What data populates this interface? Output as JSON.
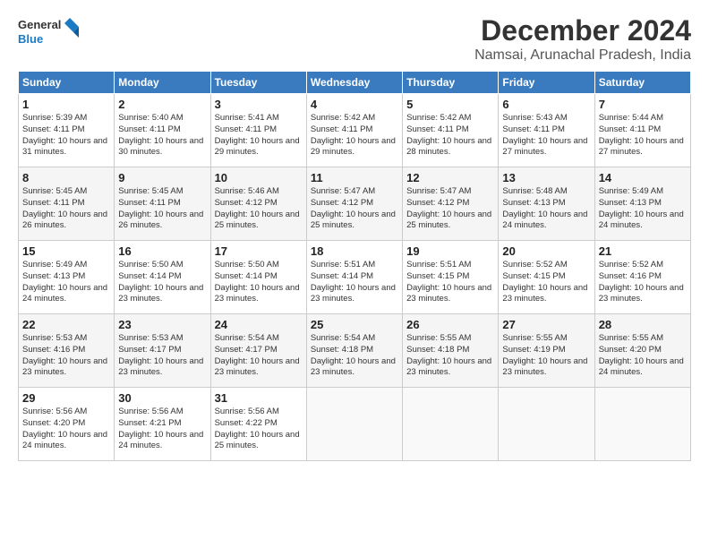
{
  "logo": {
    "line1": "General",
    "line2": "Blue"
  },
  "title": "December 2024",
  "subtitle": "Namsai, Arunachal Pradesh, India",
  "days_header": [
    "Sunday",
    "Monday",
    "Tuesday",
    "Wednesday",
    "Thursday",
    "Friday",
    "Saturday"
  ],
  "weeks": [
    [
      {
        "day": "1",
        "sunrise": "5:39 AM",
        "sunset": "4:11 PM",
        "daylight": "10 hours and 31 minutes."
      },
      {
        "day": "2",
        "sunrise": "5:40 AM",
        "sunset": "4:11 PM",
        "daylight": "10 hours and 30 minutes."
      },
      {
        "day": "3",
        "sunrise": "5:41 AM",
        "sunset": "4:11 PM",
        "daylight": "10 hours and 29 minutes."
      },
      {
        "day": "4",
        "sunrise": "5:42 AM",
        "sunset": "4:11 PM",
        "daylight": "10 hours and 29 minutes."
      },
      {
        "day": "5",
        "sunrise": "5:42 AM",
        "sunset": "4:11 PM",
        "daylight": "10 hours and 28 minutes."
      },
      {
        "day": "6",
        "sunrise": "5:43 AM",
        "sunset": "4:11 PM",
        "daylight": "10 hours and 27 minutes."
      },
      {
        "day": "7",
        "sunrise": "5:44 AM",
        "sunset": "4:11 PM",
        "daylight": "10 hours and 27 minutes."
      }
    ],
    [
      {
        "day": "8",
        "sunrise": "5:45 AM",
        "sunset": "4:11 PM",
        "daylight": "10 hours and 26 minutes."
      },
      {
        "day": "9",
        "sunrise": "5:45 AM",
        "sunset": "4:11 PM",
        "daylight": "10 hours and 26 minutes."
      },
      {
        "day": "10",
        "sunrise": "5:46 AM",
        "sunset": "4:12 PM",
        "daylight": "10 hours and 25 minutes."
      },
      {
        "day": "11",
        "sunrise": "5:47 AM",
        "sunset": "4:12 PM",
        "daylight": "10 hours and 25 minutes."
      },
      {
        "day": "12",
        "sunrise": "5:47 AM",
        "sunset": "4:12 PM",
        "daylight": "10 hours and 25 minutes."
      },
      {
        "day": "13",
        "sunrise": "5:48 AM",
        "sunset": "4:13 PM",
        "daylight": "10 hours and 24 minutes."
      },
      {
        "day": "14",
        "sunrise": "5:49 AM",
        "sunset": "4:13 PM",
        "daylight": "10 hours and 24 minutes."
      }
    ],
    [
      {
        "day": "15",
        "sunrise": "5:49 AM",
        "sunset": "4:13 PM",
        "daylight": "10 hours and 24 minutes."
      },
      {
        "day": "16",
        "sunrise": "5:50 AM",
        "sunset": "4:14 PM",
        "daylight": "10 hours and 23 minutes."
      },
      {
        "day": "17",
        "sunrise": "5:50 AM",
        "sunset": "4:14 PM",
        "daylight": "10 hours and 23 minutes."
      },
      {
        "day": "18",
        "sunrise": "5:51 AM",
        "sunset": "4:14 PM",
        "daylight": "10 hours and 23 minutes."
      },
      {
        "day": "19",
        "sunrise": "5:51 AM",
        "sunset": "4:15 PM",
        "daylight": "10 hours and 23 minutes."
      },
      {
        "day": "20",
        "sunrise": "5:52 AM",
        "sunset": "4:15 PM",
        "daylight": "10 hours and 23 minutes."
      },
      {
        "day": "21",
        "sunrise": "5:52 AM",
        "sunset": "4:16 PM",
        "daylight": "10 hours and 23 minutes."
      }
    ],
    [
      {
        "day": "22",
        "sunrise": "5:53 AM",
        "sunset": "4:16 PM",
        "daylight": "10 hours and 23 minutes."
      },
      {
        "day": "23",
        "sunrise": "5:53 AM",
        "sunset": "4:17 PM",
        "daylight": "10 hours and 23 minutes."
      },
      {
        "day": "24",
        "sunrise": "5:54 AM",
        "sunset": "4:17 PM",
        "daylight": "10 hours and 23 minutes."
      },
      {
        "day": "25",
        "sunrise": "5:54 AM",
        "sunset": "4:18 PM",
        "daylight": "10 hours and 23 minutes."
      },
      {
        "day": "26",
        "sunrise": "5:55 AM",
        "sunset": "4:18 PM",
        "daylight": "10 hours and 23 minutes."
      },
      {
        "day": "27",
        "sunrise": "5:55 AM",
        "sunset": "4:19 PM",
        "daylight": "10 hours and 23 minutes."
      },
      {
        "day": "28",
        "sunrise": "5:55 AM",
        "sunset": "4:20 PM",
        "daylight": "10 hours and 24 minutes."
      }
    ],
    [
      {
        "day": "29",
        "sunrise": "5:56 AM",
        "sunset": "4:20 PM",
        "daylight": "10 hours and 24 minutes."
      },
      {
        "day": "30",
        "sunrise": "5:56 AM",
        "sunset": "4:21 PM",
        "daylight": "10 hours and 24 minutes."
      },
      {
        "day": "31",
        "sunrise": "5:56 AM",
        "sunset": "4:22 PM",
        "daylight": "10 hours and 25 minutes."
      },
      null,
      null,
      null,
      null
    ]
  ]
}
